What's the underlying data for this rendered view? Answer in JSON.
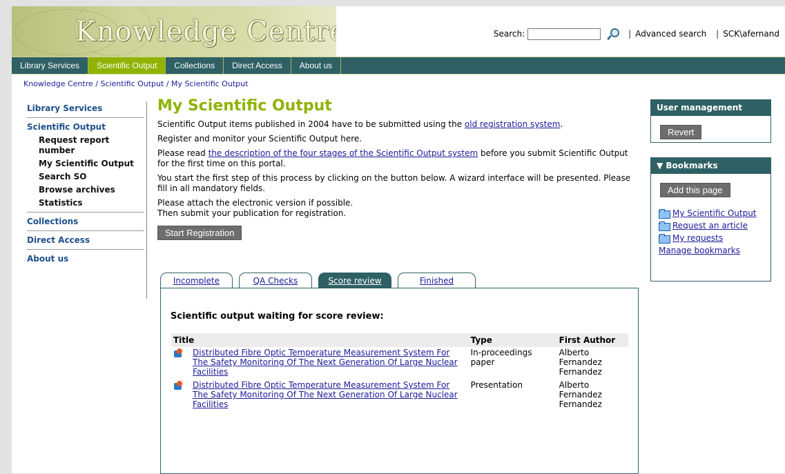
{
  "header": {
    "logo_text": "Knowledge Centre",
    "search_label": "Search:",
    "search_value": "",
    "advanced_search": "Advanced search",
    "user": "SCK\\afernand"
  },
  "nav": [
    "Library Services",
    "Scientific Output",
    "Collections",
    "Direct Access",
    "About us"
  ],
  "nav_active": "Scientific Output",
  "breadcrumb": "Knowledge Centre / Scientific Output / My Scientific Output",
  "sidebar": {
    "library_services": "Library Services",
    "scientific_output": "Scientific Output",
    "sub": [
      "Request report number",
      "My Scientific Output",
      "Search SO",
      "Browse archives",
      "Statistics"
    ],
    "collections": "Collections",
    "direct_access": "Direct Access",
    "about_us": "About us"
  },
  "main": {
    "title": "My Scientific Output",
    "p1_before": "Scientific Output items published in 2004 have to be submitted using the ",
    "p1_link": "old registration system",
    "p1_after": ".",
    "p2": "Register and monitor your Scientific Output here.",
    "p3_before": "Please read ",
    "p3_link": "the description of the four stages of the Scientific Output system",
    "p3_after": " before you submit Scientific Output for the first time on this portal.",
    "p4": "You start the first step of this process by clicking on the button below. A wizard interface will be presented. Please fill in all mandatory fields.",
    "p5a": "Please attach the electronic version if possible.",
    "p5b": "Then submit your publication for registration.",
    "start_button": "Start Registration"
  },
  "tabs": [
    "Incomplete",
    "QA Checks",
    "Score review",
    "Finished"
  ],
  "active_tab": "Score review",
  "panel": {
    "heading": "Scientific output waiting for score review:",
    "columns": [
      "Title",
      "Type",
      "First Author"
    ],
    "rows": [
      {
        "title": "Distributed Fibre Optic Temperature Measurement System For The Safety Monitoring Of The Next Generation Of Large Nuclear Facilities",
        "type": "In-proceedings paper",
        "author": "Alberto Fernandez Fernandez"
      },
      {
        "title": "Distributed Fibre Optic Temperature Measurement System For The Safety Monitoring Of The Next Generation Of Large Nuclear Facilities",
        "type": "Presentation",
        "author": "Alberto Fernandez Fernandez"
      }
    ]
  },
  "user_management": {
    "header": "User management",
    "revert_button": "Revert"
  },
  "bookmarks": {
    "header": "▼ Bookmarks",
    "add_button": "Add this page",
    "links": [
      "My Scientific Output",
      "Request an article",
      "My requests"
    ],
    "manage": "Manage bookmarks"
  },
  "colors": {
    "nav_bg": "#2e6064",
    "accent": "#8fb300",
    "link": "#1a1a99"
  }
}
